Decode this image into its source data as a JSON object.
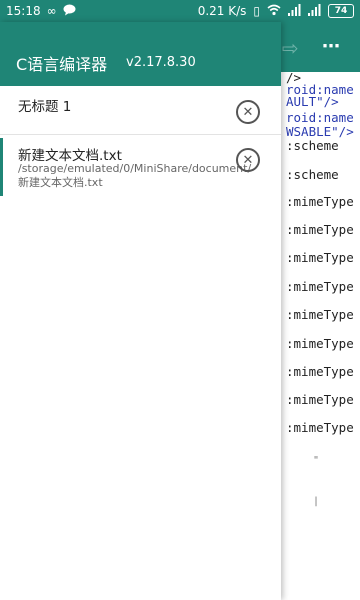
{
  "status_bar": {
    "time": "15:18",
    "speed": "0.21 K/s",
    "battery": "74"
  },
  "drawer": {
    "app_title": "C语言编译器",
    "app_version": "v2.17.8.30",
    "files": [
      {
        "name": "无标题 1",
        "path": ""
      },
      {
        "name": "新建文本文档.txt",
        "path": "/storage/emulated/0/MiniShare/document/新建文本文档.txt"
      }
    ]
  },
  "editor": {
    "lines": [
      "/>",
      "roid:name",
      "AULT\"/>",
      "roid:name",
      "WSABLE\"/>",
      ":scheme",
      ":scheme",
      ":mimeType",
      ":mimeType",
      ":mimeType",
      ":mimeType",
      ":mimeType",
      ":mimeType",
      ":mimeType",
      ":mimeType",
      ":mimeType"
    ]
  },
  "colors": {
    "primary": "#1f8576",
    "code_blue": "#2a3bb0"
  }
}
